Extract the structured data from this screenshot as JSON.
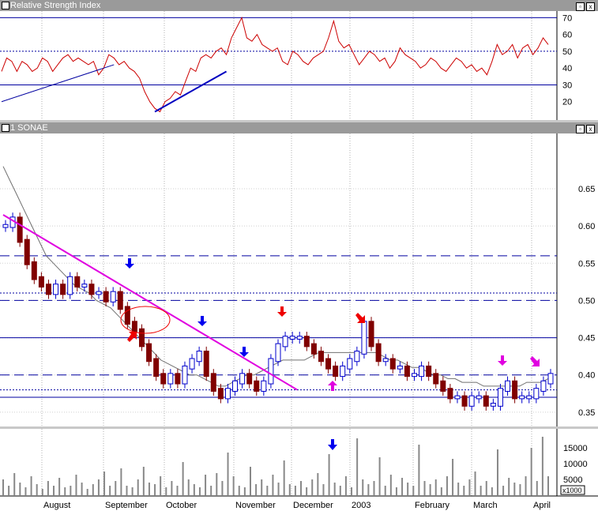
{
  "chart_data": [
    {
      "type": "line",
      "title": "Relative Strength Index",
      "ylim": [
        10,
        73
      ],
      "yticks": [
        20,
        30,
        40,
        50,
        60,
        70
      ],
      "reference_lines": [
        30,
        50,
        70
      ],
      "series": [
        {
          "values": [
            38,
            46,
            44,
            38,
            44,
            42,
            38,
            40,
            46,
            44,
            38,
            42,
            46,
            48,
            44,
            46,
            44,
            42,
            44,
            36,
            40,
            48,
            46,
            42,
            44,
            40,
            38,
            34,
            26,
            20,
            16,
            14,
            20,
            22,
            26,
            24,
            32,
            40,
            38,
            46,
            48,
            46,
            50,
            52,
            48,
            58,
            64,
            70,
            58,
            56,
            60,
            54,
            52,
            50,
            52,
            44,
            42,
            50,
            48,
            44,
            42,
            46,
            48,
            50,
            58,
            68,
            56,
            52,
            54,
            48,
            42,
            46,
            50,
            48,
            44,
            46,
            40,
            44,
            52,
            48,
            46,
            44,
            40,
            42,
            46,
            44,
            40,
            38,
            42,
            46,
            44,
            40,
            42,
            38,
            40,
            36,
            44,
            54,
            48,
            50,
            54,
            46,
            52,
            54,
            48,
            52,
            58,
            54
          ]
        }
      ],
      "trendlines": [
        {
          "from": [
            0,
            20
          ],
          "to": [
            22,
            42
          ],
          "color": "#0000a0"
        },
        {
          "from": [
            30,
            14
          ],
          "to": [
            44,
            38
          ],
          "color": "#0000c0"
        }
      ]
    },
    {
      "type": "bar",
      "title": "1 SONAE",
      "ylim": [
        0.335,
        0.72
      ],
      "yticks": [
        0.35,
        0.4,
        0.45,
        0.5,
        0.55,
        0.6,
        0.65
      ],
      "ytick_labels": [
        "0.35",
        "0.40",
        "0.45",
        "0.50",
        "0.55",
        "0.60",
        "0.65"
      ],
      "horizontal_levels": [
        {
          "y": 0.56,
          "style": "dashed"
        },
        {
          "y": 0.51,
          "style": "dotted"
        },
        {
          "y": 0.5,
          "style": "dashed"
        },
        {
          "y": 0.45,
          "style": "solid"
        },
        {
          "y": 0.4,
          "style": "dashed"
        },
        {
          "y": 0.38,
          "style": "dotted"
        },
        {
          "y": 0.37,
          "style": "solid"
        }
      ],
      "price": [
        0.6,
        0.61,
        0.58,
        0.55,
        0.53,
        0.52,
        0.51,
        0.52,
        0.51,
        0.53,
        0.52,
        0.52,
        0.51,
        0.51,
        0.5,
        0.51,
        0.49,
        0.47,
        0.46,
        0.44,
        0.42,
        0.4,
        0.39,
        0.4,
        0.39,
        0.41,
        0.42,
        0.43,
        0.4,
        0.38,
        0.37,
        0.38,
        0.39,
        0.4,
        0.39,
        0.38,
        0.39,
        0.42,
        0.44,
        0.45,
        0.45,
        0.45,
        0.44,
        0.43,
        0.42,
        0.41,
        0.4,
        0.41,
        0.42,
        0.43,
        0.47,
        0.44,
        0.42,
        0.42,
        0.41,
        0.41,
        0.4,
        0.4,
        0.41,
        0.4,
        0.39,
        0.38,
        0.37,
        0.37,
        0.36,
        0.37,
        0.37,
        0.36,
        0.36,
        0.38,
        0.39,
        0.37,
        0.37,
        0.37,
        0.38,
        0.39,
        0.4
      ],
      "moving_average": [
        0.68,
        0.66,
        0.64,
        0.62,
        0.6,
        0.58,
        0.56,
        0.55,
        0.54,
        0.53,
        0.52,
        0.515,
        0.51,
        0.5,
        0.495,
        0.49,
        0.48,
        0.47,
        0.46,
        0.45,
        0.44,
        0.43,
        0.42,
        0.415,
        0.41,
        0.405,
        0.4,
        0.4,
        0.395,
        0.39,
        0.385,
        0.385,
        0.39,
        0.395,
        0.4,
        0.4,
        0.405,
        0.41,
        0.415,
        0.42,
        0.42,
        0.42,
        0.42,
        0.425,
        0.43,
        0.43,
        0.43,
        0.43,
        0.43,
        0.43,
        0.43,
        0.43,
        0.43,
        0.425,
        0.42,
        0.42,
        0.415,
        0.41,
        0.41,
        0.405,
        0.4,
        0.4,
        0.395,
        0.395,
        0.39,
        0.39,
        0.39,
        0.385,
        0.385,
        0.385,
        0.385,
        0.385,
        0.385,
        0.39,
        0.39,
        0.39,
        0.395
      ],
      "trendline": {
        "from": [
          0,
          0.615
        ],
        "to": [
          41,
          0.38
        ],
        "color": "#e000e0"
      }
    },
    {
      "type": "bar",
      "title": "",
      "ylim": [
        0,
        20000
      ],
      "yticks": [
        5000,
        10000,
        15000
      ],
      "ytick_labels": [
        "5000",
        "10000",
        "15000"
      ],
      "unit_label": "x1000",
      "values": [
        5000,
        3000,
        7000,
        4000,
        2500,
        6000,
        3500,
        2000,
        4500,
        3000,
        5500,
        2500,
        3000,
        6500,
        4000,
        2000,
        3500,
        5000,
        7500,
        3000,
        4500,
        8500,
        3000,
        2500,
        5000,
        9000,
        4000,
        3500,
        6000,
        2500,
        4500,
        3000,
        10500,
        5000,
        3500,
        2500,
        6500,
        3000,
        7000,
        4500,
        13500,
        6000,
        3000,
        2500,
        9000,
        3500,
        5000,
        3000,
        6500,
        4000,
        11000,
        3500,
        3000,
        4500,
        2500,
        5000,
        7000,
        3500,
        13000,
        4000,
        3000,
        6000,
        2500,
        18000,
        5000,
        3500,
        4500,
        12000,
        3000,
        6500,
        2500,
        5500,
        4000,
        3000,
        16000,
        4500,
        3500,
        5000,
        2500,
        6000,
        11500,
        4000,
        3000,
        5000,
        7500,
        3000,
        4500,
        2500,
        14500,
        3000,
        5500,
        4000,
        3500,
        6000,
        15000,
        4500,
        18500,
        6000
      ],
      "x_labels": [
        "August",
        "September",
        "October",
        "November",
        "December",
        "2003",
        "February",
        "March",
        "April"
      ]
    }
  ],
  "panels": {
    "rsi_title": "Relative Strength Index",
    "price_title": "1 SONAE",
    "close_glyph": "x",
    "restore_glyph": "▫"
  },
  "colors": {
    "rsi_line": "#cc0000",
    "up_bar": "#0000cc",
    "down_bar": "#800000",
    "ma_line": "#707070",
    "magenta": "#e000e0",
    "blue_arrow": "#0000ee",
    "red_arrow": "#ee0000"
  }
}
